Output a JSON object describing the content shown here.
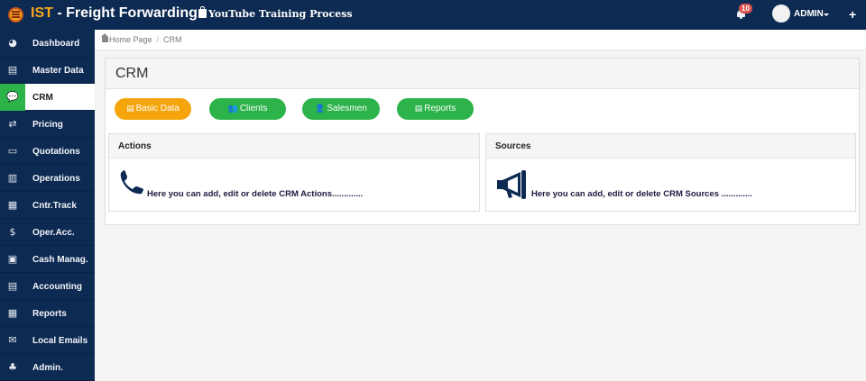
{
  "header": {
    "brand": "IST",
    "title": " - Freight Forwarding -",
    "training": "YouTube Training Process",
    "notification_count": "10",
    "user": "ADMIN",
    "add_symbol": "+"
  },
  "sidebar": {
    "items": [
      {
        "label": "Dashboard",
        "icon": "dashboard-icon",
        "glyph": "◕"
      },
      {
        "label": "Master Data",
        "icon": "table-icon",
        "glyph": "▤"
      },
      {
        "label": "CRM",
        "icon": "chat-icon",
        "glyph": "💬",
        "active": true
      },
      {
        "label": "Pricing",
        "icon": "shuffle-icon",
        "glyph": "⇄"
      },
      {
        "label": "Quotations",
        "icon": "desktop-icon",
        "glyph": "▭"
      },
      {
        "label": "Operations",
        "icon": "keyboard-icon",
        "glyph": "▥"
      },
      {
        "label": "Cntr.Track",
        "icon": "container-icon",
        "glyph": "▦"
      },
      {
        "label": "Oper.Acc.",
        "icon": "dollar-icon",
        "glyph": "$"
      },
      {
        "label": "Cash Manag.",
        "icon": "money-icon",
        "glyph": "▣"
      },
      {
        "label": "Accounting",
        "icon": "ledger-icon",
        "glyph": "▤"
      },
      {
        "label": "Reports",
        "icon": "report-table-icon",
        "glyph": "▦"
      },
      {
        "label": "Local Emails",
        "icon": "envelope-icon",
        "glyph": "✉"
      },
      {
        "label": "Admin.",
        "icon": "sitemap-icon",
        "glyph": "♣"
      }
    ]
  },
  "breadcrumb": {
    "home": "Home Page",
    "separator": "/",
    "current": "CRM"
  },
  "page": {
    "title": "CRM",
    "buttons": [
      {
        "label": "Basic Data",
        "icon": "table-icon",
        "glyph": "▤",
        "color": "#f5a50b"
      },
      {
        "label": "Clients",
        "icon": "users-icon",
        "glyph": "👥",
        "color": "#2cb34a"
      },
      {
        "label": "Salesmen",
        "icon": "male-icon",
        "glyph": "👤",
        "color": "#2cb34a"
      },
      {
        "label": "Reports",
        "icon": "table-icon",
        "glyph": "▤",
        "color": "#2cb34a"
      }
    ],
    "cards": [
      {
        "title": "Actions",
        "text": "Here you can add, edit or delete CRM Actions.............",
        "icon": "phone-icon"
      },
      {
        "title": "Sources",
        "text": "Here you can add, edit or delete CRM Sources .............",
        "icon": "megaphone-icon"
      }
    ]
  },
  "colors": {
    "navy": "#0d2a52",
    "brand_orange": "#f7a81b",
    "green": "#2cb34a",
    "yellow": "#f5a50b",
    "badge_red": "#d9534f"
  }
}
